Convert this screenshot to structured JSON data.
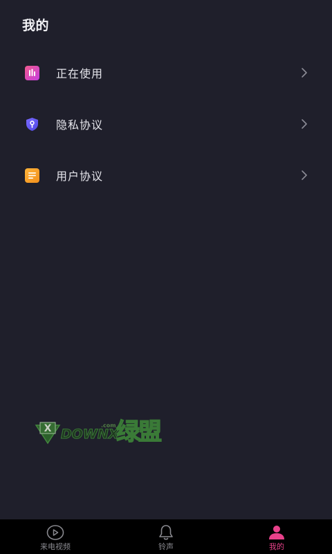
{
  "header": {
    "title": "我的"
  },
  "menu": {
    "items": [
      {
        "label": "正在使用",
        "icon": "equalizer-icon",
        "icon_color": "#e8418a"
      },
      {
        "label": "隐私协议",
        "icon": "shield-key-icon",
        "icon_color": "#6b5cff"
      },
      {
        "label": "用户协议",
        "icon": "document-lines-icon",
        "icon_color": "#f7a12a"
      }
    ],
    "chevron_icon": "chevron-right-icon"
  },
  "watermark": {
    "text": "DOWNX",
    "suffix": ".com",
    "cn": "绿盟"
  },
  "tabbar": {
    "tabs": [
      {
        "label": "来电视频",
        "icon": "play-circle-icon",
        "active": false
      },
      {
        "label": "铃声",
        "icon": "bell-icon",
        "active": false
      },
      {
        "label": "我的",
        "icon": "person-icon",
        "active": true
      }
    ],
    "active_color": "#e8418a",
    "inactive_color": "#8a8a90"
  },
  "theme": {
    "background": "#1f1f2b",
    "tabbar_background": "#000000"
  }
}
